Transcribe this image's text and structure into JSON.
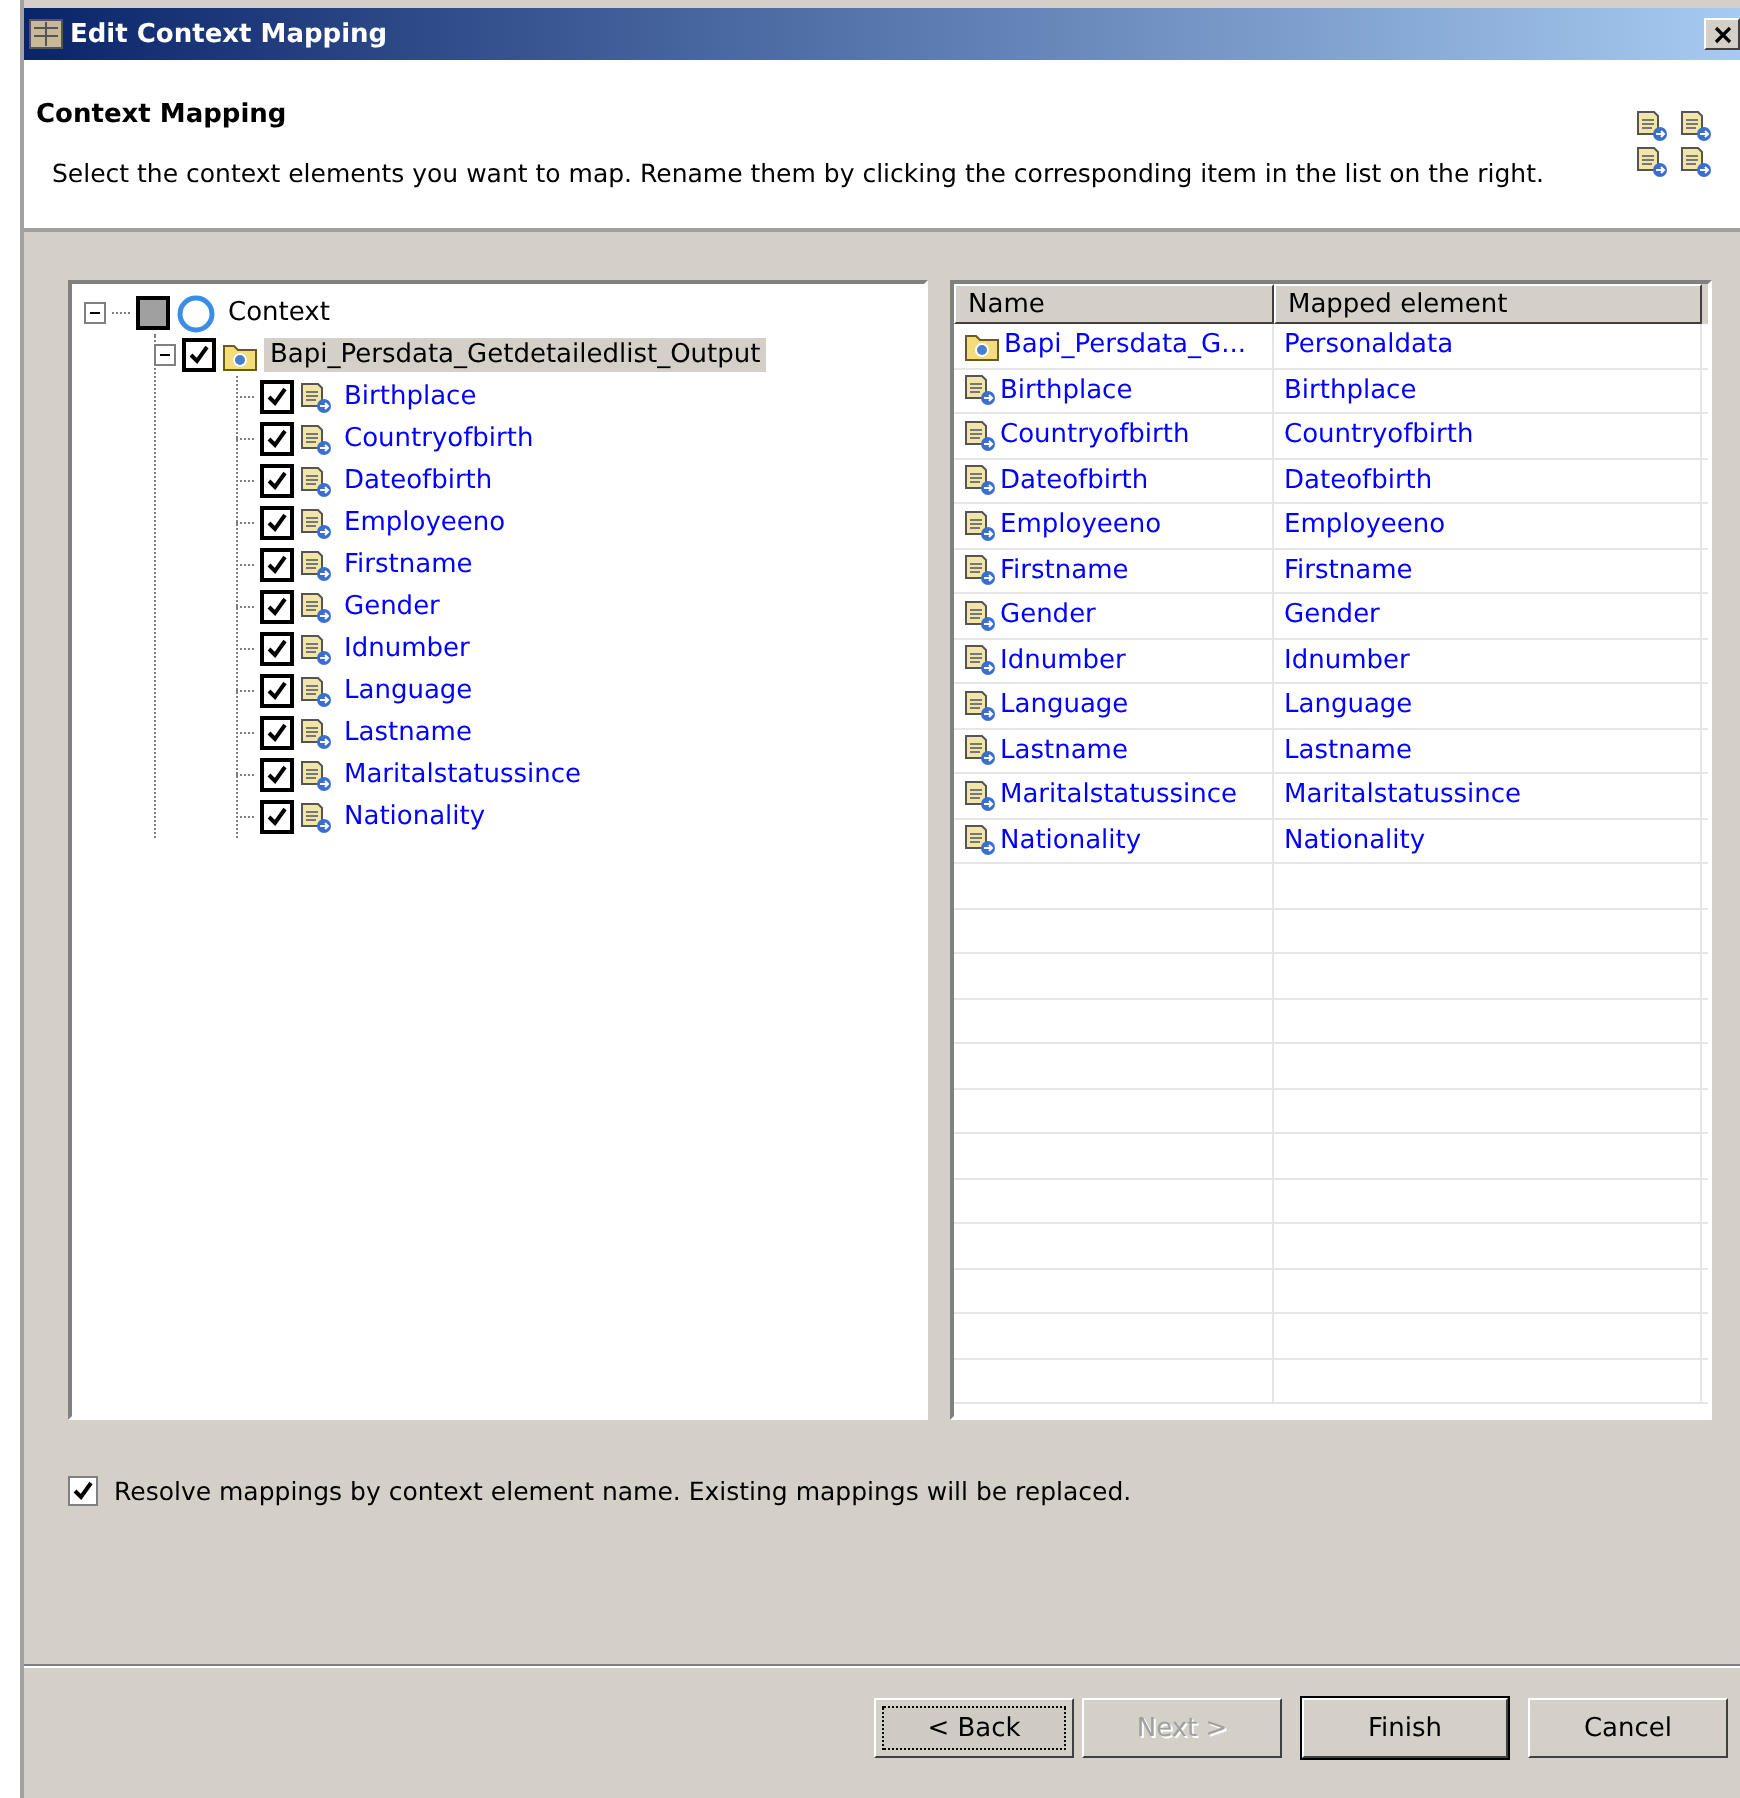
{
  "window": {
    "title": "Edit Context Mapping"
  },
  "header": {
    "title": "Context Mapping",
    "description": "Select the context elements you want to map. Rename them by clicking the corresponding item in the list on the right."
  },
  "tree": [
    {
      "label": "Context",
      "kind": "context",
      "checked": false,
      "grayed": true,
      "expanded": true,
      "selected": false,
      "children": [
        {
          "label": "Bapi_Persdata_Getdetailedlist_Output",
          "kind": "node",
          "checked": true,
          "expanded": true,
          "selected": true,
          "children": [
            {
              "label": "Birthplace",
              "kind": "attribute",
              "checked": true,
              "selected": false
            },
            {
              "label": "Countryofbirth",
              "kind": "attribute",
              "checked": true,
              "selected": false
            },
            {
              "label": "Dateofbirth",
              "kind": "attribute",
              "checked": true,
              "selected": false
            },
            {
              "label": "Employeeno",
              "kind": "attribute",
              "checked": true,
              "selected": false
            },
            {
              "label": "Firstname",
              "kind": "attribute",
              "checked": true,
              "selected": false
            },
            {
              "label": "Gender",
              "kind": "attribute",
              "checked": true,
              "selected": false
            },
            {
              "label": "Idnumber",
              "kind": "attribute",
              "checked": true,
              "selected": false
            },
            {
              "label": "Language",
              "kind": "attribute",
              "checked": true,
              "selected": false
            },
            {
              "label": "Lastname",
              "kind": "attribute",
              "checked": true,
              "selected": false
            },
            {
              "label": "Maritalstatussince",
              "kind": "attribute",
              "checked": true,
              "selected": false
            },
            {
              "label": "Nationality",
              "kind": "attribute",
              "checked": true,
              "selected": false
            }
          ]
        }
      ]
    }
  ],
  "table": {
    "columns": [
      "Name",
      "Mapped element"
    ],
    "rows": [
      {
        "kind": "node",
        "name": "Bapi_Persdata_G...",
        "mapped": "Personaldata"
      },
      {
        "kind": "attribute",
        "name": "Birthplace",
        "mapped": "Birthplace"
      },
      {
        "kind": "attribute",
        "name": "Countryofbirth",
        "mapped": "Countryofbirth"
      },
      {
        "kind": "attribute",
        "name": "Dateofbirth",
        "mapped": "Dateofbirth"
      },
      {
        "kind": "attribute",
        "name": "Employeeno",
        "mapped": "Employeeno"
      },
      {
        "kind": "attribute",
        "name": "Firstname",
        "mapped": "Firstname"
      },
      {
        "kind": "attribute",
        "name": "Gender",
        "mapped": "Gender"
      },
      {
        "kind": "attribute",
        "name": "Idnumber",
        "mapped": "Idnumber"
      },
      {
        "kind": "attribute",
        "name": "Language",
        "mapped": "Language"
      },
      {
        "kind": "attribute",
        "name": "Lastname",
        "mapped": "Lastname"
      },
      {
        "kind": "attribute",
        "name": "Maritalstatussince",
        "mapped": "Maritalstatussince"
      },
      {
        "kind": "attribute",
        "name": "Nationality",
        "mapped": "Nationality"
      }
    ]
  },
  "resolve_option": {
    "label": "Resolve mappings by context element name. Existing mappings will be replaced.",
    "checked": true
  },
  "buttons": [
    {
      "label": "< Back",
      "disabled": false,
      "default": false,
      "focused": true
    },
    {
      "label": "Next >",
      "disabled": true,
      "default": false,
      "focused": false
    },
    {
      "label": "Finish",
      "disabled": false,
      "default": true,
      "focused": false
    },
    {
      "label": "Cancel",
      "disabled": false,
      "default": false,
      "focused": false
    }
  ]
}
